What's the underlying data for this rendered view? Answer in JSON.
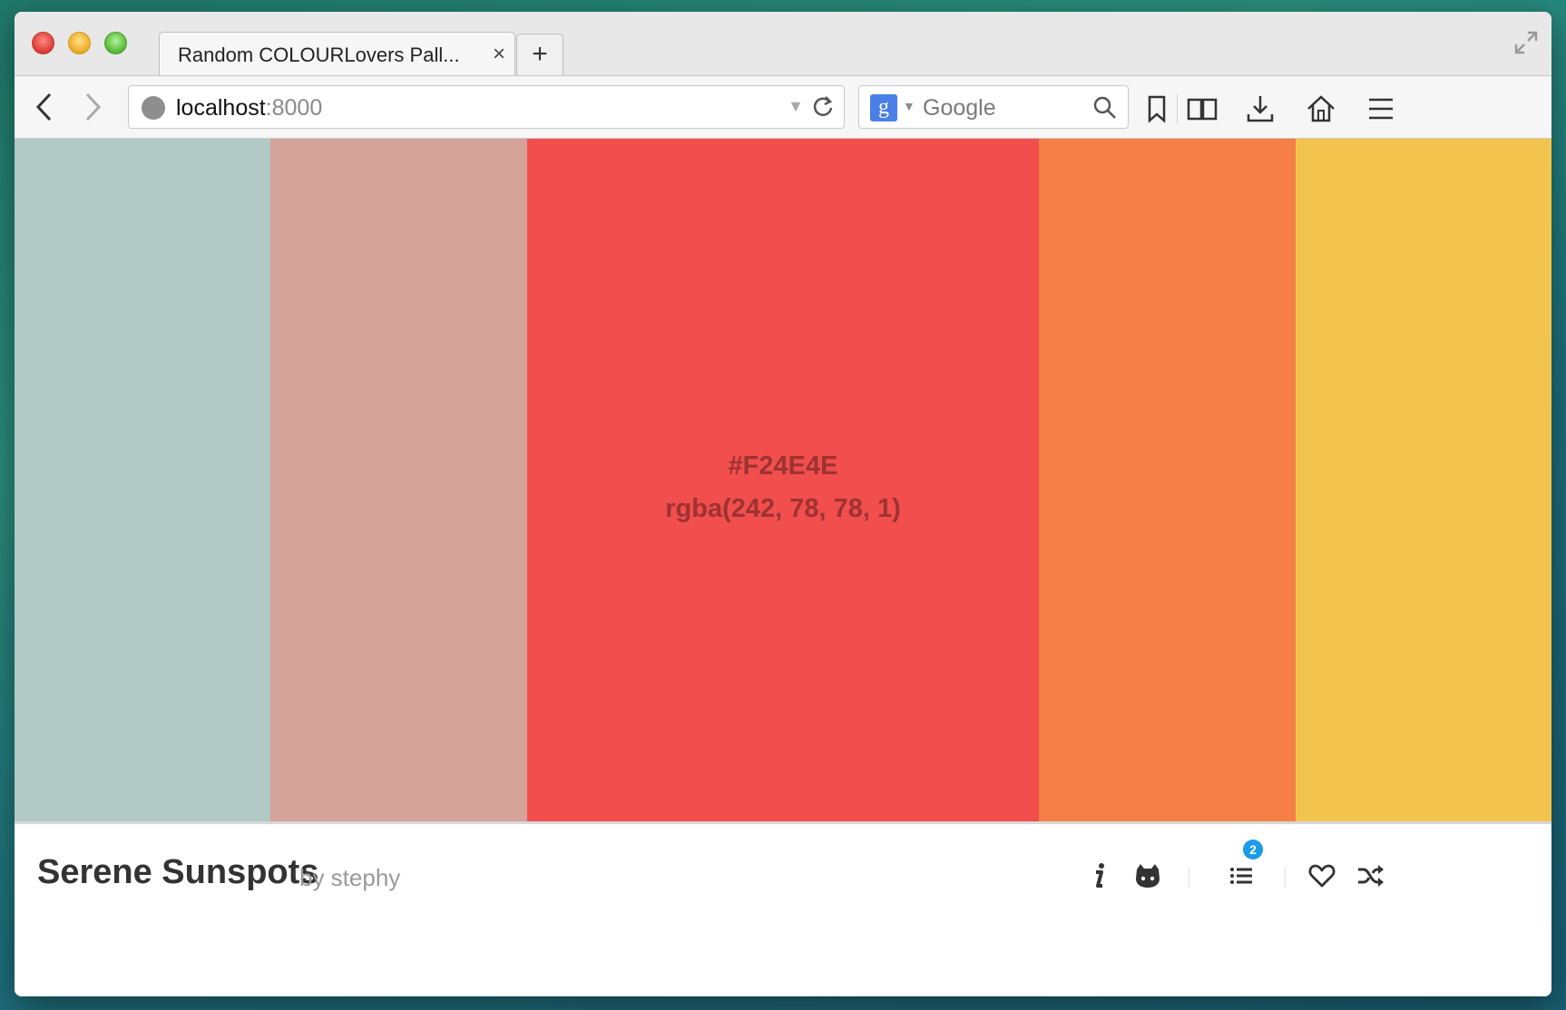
{
  "browser": {
    "tab_title": "Random COLOURLovers Pall...",
    "tab_close": "×",
    "new_tab": "+",
    "url_host": "localhost",
    "url_port": ":8000",
    "search_engine_letter": "g",
    "search_placeholder": "Google"
  },
  "swatches": [
    {
      "hex": "#B1C8C4",
      "width_frac": 0.1667
    },
    {
      "hex": "#D4A39A",
      "width_frac": 0.1667
    },
    {
      "hex": "#F24E4E",
      "width_frac": 0.3333,
      "label_hex": "#F24E4E",
      "label_rgba": "rgba(242, 78, 78, 1)"
    },
    {
      "hex": "#F57F46",
      "width_frac": 0.1667
    },
    {
      "hex": "#F2C44E",
      "width_frac": 0.1667
    }
  ],
  "footer": {
    "palette_title": "Serene Sunspots",
    "palette_author": "by stephy",
    "list_badge_count": "2",
    "icons": [
      "info-icon",
      "github-icon",
      "list-icon",
      "heart-icon",
      "shuffle-icon"
    ]
  },
  "colors": {
    "badge": "#1a9be8",
    "text": "#333333"
  }
}
